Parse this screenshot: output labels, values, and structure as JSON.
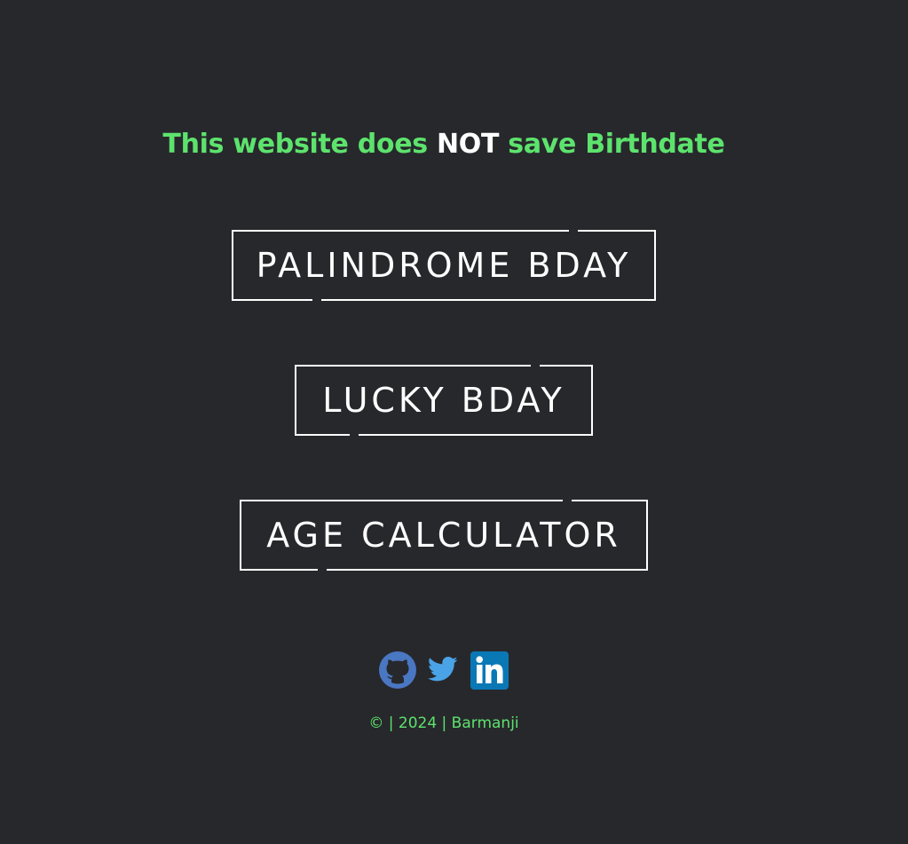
{
  "notice": {
    "part1": "This website does ",
    "part2": "NOT",
    "part3": " save Birthdate"
  },
  "buttons": {
    "palindrome": "PALINDROME BDAY",
    "lucky": "LUCKY BDAY",
    "age": "AGE CALCULATOR"
  },
  "socials": {
    "github": "github-icon",
    "twitter": "twitter-icon",
    "linkedin": "linkedin-icon"
  },
  "footer": {
    "text": "© | 2024 | Barmanji"
  },
  "colors": {
    "background": "#27282c",
    "accent": "#5de36d",
    "text": "#ffffff",
    "github": "#4a77c2",
    "twitter": "#4aa3e6",
    "linkedin": "#0a78b5"
  }
}
